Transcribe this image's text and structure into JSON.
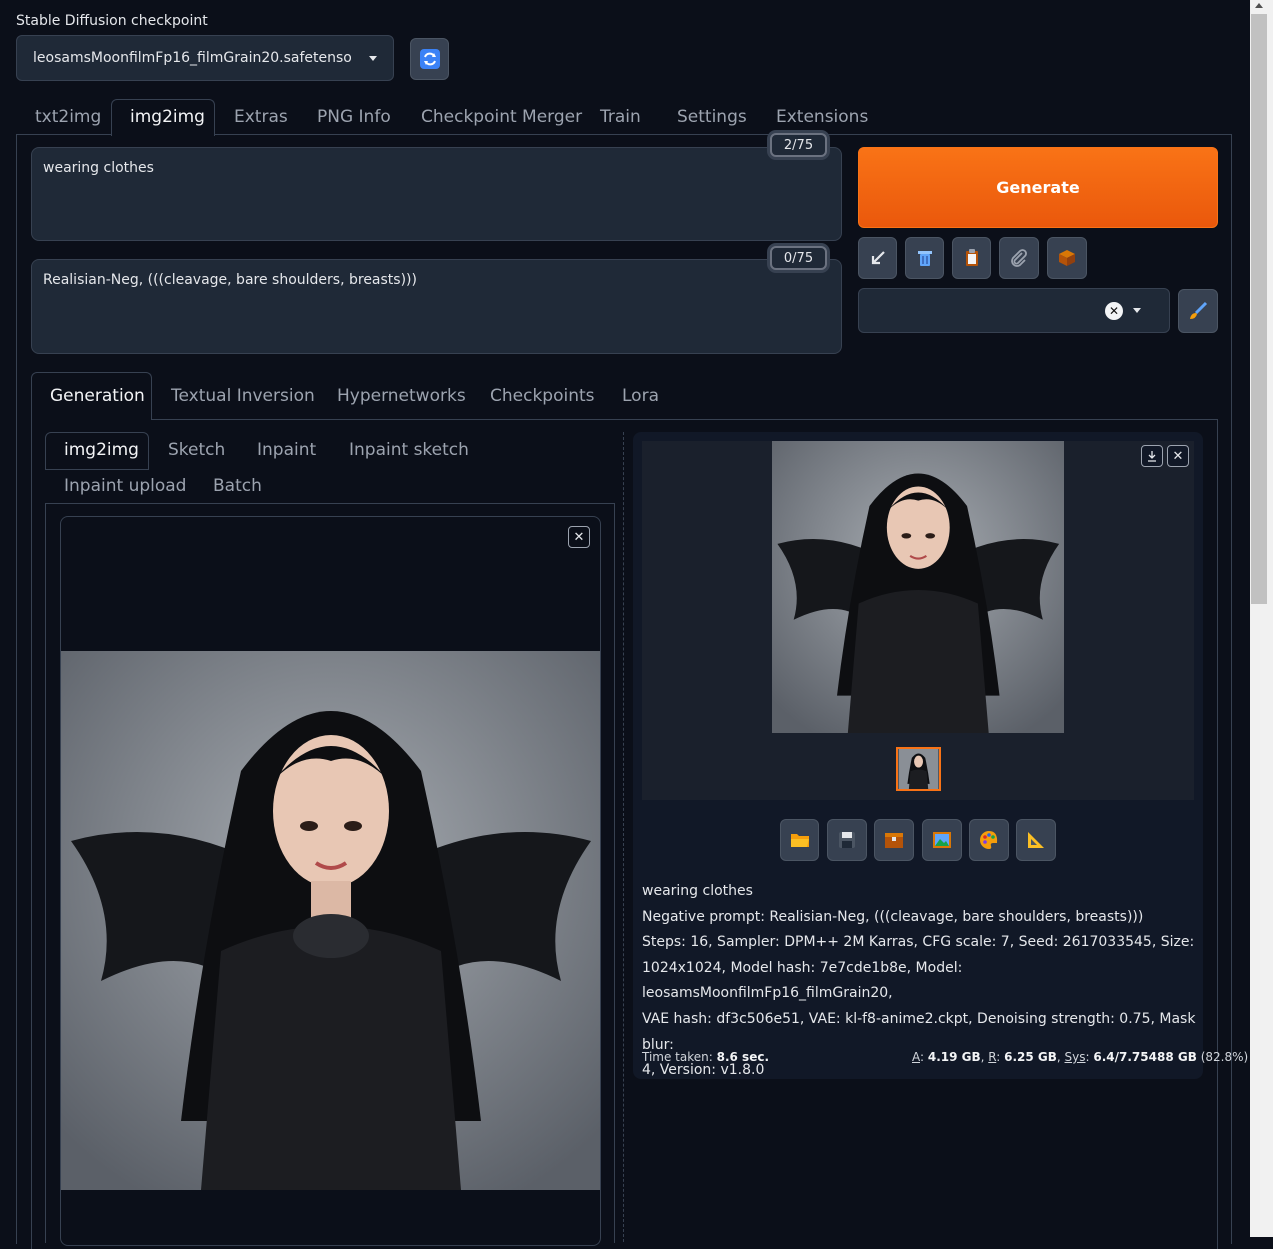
{
  "checkpoint": {
    "label": "Stable Diffusion checkpoint",
    "value": "leosamsMoonfilmFp16_filmGrain20.safetensors",
    "refresh_icon": "refresh-icon"
  },
  "main_tabs": [
    "txt2img",
    "img2img",
    "Extras",
    "PNG Info",
    "Checkpoint Merger",
    "Train",
    "Settings",
    "Extensions"
  ],
  "prompt": {
    "value": "wearing clothes",
    "counter": "2/75"
  },
  "negative_prompt": {
    "value": "Realisian-Neg, (((cleavage, bare shoulders, breasts)))",
    "counter": "0/75"
  },
  "generate_label": "Generate",
  "tool_icons": [
    "arrow-icon",
    "trash-icon",
    "clipboard-icon",
    "paperclip-icon",
    "box-icon"
  ],
  "style_select": {
    "value": ""
  },
  "sub_tabs": [
    "Generation",
    "Textual Inversion",
    "Hypernetworks",
    "Checkpoints",
    "Lora"
  ],
  "img_tabs": [
    "img2img",
    "Sketch",
    "Inpaint",
    "Inpaint sketch",
    "Inpaint upload",
    "Batch"
  ],
  "output_icons": [
    "folder-icon",
    "save-icon",
    "zip-icon",
    "image-icon",
    "palette-icon",
    "ruler-icon"
  ],
  "info": {
    "line1": "wearing clothes",
    "line2": "Negative prompt: Realisian-Neg, (((cleavage, bare shoulders, breasts)))",
    "line3": "Steps: 16, Sampler: DPM++ 2M Karras, CFG scale: 7, Seed: 2617033545, Size:",
    "line4": "1024x1024, Model hash: 7e7cde1b8e, Model: leosamsMoonfilmFp16_filmGrain20,",
    "line5": "VAE hash: df3c506e51, VAE: kl-f8-anime2.ckpt, Denoising strength: 0.75, Mask blur:",
    "line6": "4, Version: v1.8.0"
  },
  "stats": {
    "time_label": "Time taken:",
    "time_value": "8.6 sec.",
    "a_label": "A",
    "a_value": "4.19 GB",
    "r_label": "R",
    "r_value": "6.25 GB",
    "sys_label": "Sys",
    "sys_value": "6.4/7.75488 GB",
    "sys_pct": "(82.8%)"
  }
}
